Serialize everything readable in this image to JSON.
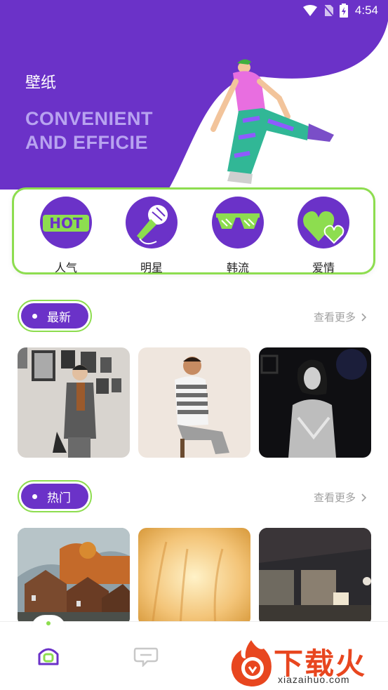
{
  "status_bar": {
    "time": "4:54"
  },
  "hero": {
    "title": "壁纸",
    "subtitle": "CONVENIENT AND EFFICIE"
  },
  "categories": [
    {
      "label": "人气",
      "icon": "hot-icon"
    },
    {
      "label": "明星",
      "icon": "microphone-icon"
    },
    {
      "label": "韩流",
      "icon": "sunglasses-icon"
    },
    {
      "label": "爱情",
      "icon": "hearts-icon"
    }
  ],
  "sections": {
    "latest": {
      "label": "最新",
      "more": "查看更多"
    },
    "hot": {
      "label": "热门",
      "more": "查看更多"
    }
  },
  "bottom_nav": [
    {
      "name": "home",
      "icon": "home-icon",
      "active": true
    },
    {
      "name": "messages",
      "icon": "chat-icon",
      "active": false
    }
  ],
  "watermark": {
    "brand": "下载火",
    "url": "xiazaihuo.com"
  },
  "colors": {
    "primary": "#6b32c8",
    "accent": "#8ddd4f",
    "brand_orange": "#e8461f"
  }
}
